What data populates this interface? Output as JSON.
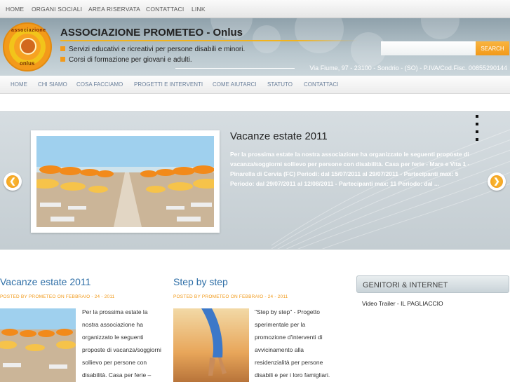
{
  "top_nav": [
    "HOME",
    "ORGANI SOCIALI",
    "AREA RISERVATA",
    "CONTATTACI",
    "LINK"
  ],
  "header": {
    "logo_text_top": "associazione",
    "logo_text_bottom": "onlus",
    "title": "ASSOCIAZIONE PROMETEO - Onlus",
    "taglines": [
      "Servizi educativi e ricreativi per persone disabili e minori.",
      "Corsi di formazione per giovani e adulti."
    ],
    "address": "Via Fiume, 97 - 23100 - Sondrio - (SO) - P.IVA/Cod.Fisc. 00855290144",
    "search_placeholder": "",
    "search_button": "SEARCH"
  },
  "main_nav": [
    "HOME",
    "CHI SIAMO",
    "COSA FACCIAMO",
    "PROGETTI E INTERVENTI",
    "COME AIUTARCI",
    "STATUTO",
    "CONTATTACI"
  ],
  "slider": {
    "title": "Vacanze estate 2011",
    "text": "Per la prossima estate la nostra associazione ha organizzato le seguenti proposte di vacanza/soggiorni sollievo per persone con disabilità. Casa per ferie -  Mare e Vita 1 - Pinarella di Cervia (FC) Periodi:   dal 15/07/2011 al 29/07/2011 - Partecipanti max:    5 Periodo:  dal 29/07/2011 al 12/08/2011 - Partecipanti max:  11 Periodo:  dal ...",
    "prev_arrow": "❮",
    "next_arrow": "❯"
  },
  "posts": [
    {
      "title": "Vacanze estate 2011",
      "meta": "POSTED BY PROMETEO ON FEBBRAIO - 24 - 2011",
      "excerpt_lines": [
        "Per la prossima estate la",
        "nostra associazione ha",
        "organizzato le seguenti",
        "proposte di vacanza/soggiorni",
        "sollievo per persone con",
        "disabilità. Casa per ferie –"
      ]
    },
    {
      "title": "Step by step",
      "meta": "POSTED BY PROMETEO ON FEBBRAIO - 24 - 2011",
      "excerpt_lines": [
        "\"Step by step\" - Progetto",
        "sperimentale per la",
        "promozione d'interventi di",
        "avvicinamento alla",
        "residenzialità per persone",
        "disabili e per i loro famigliari."
      ]
    }
  ],
  "sidebar": {
    "widget_title": "GENITORI & INTERNET",
    "link": "Video Trailer - IL PAGLIACCIO"
  }
}
